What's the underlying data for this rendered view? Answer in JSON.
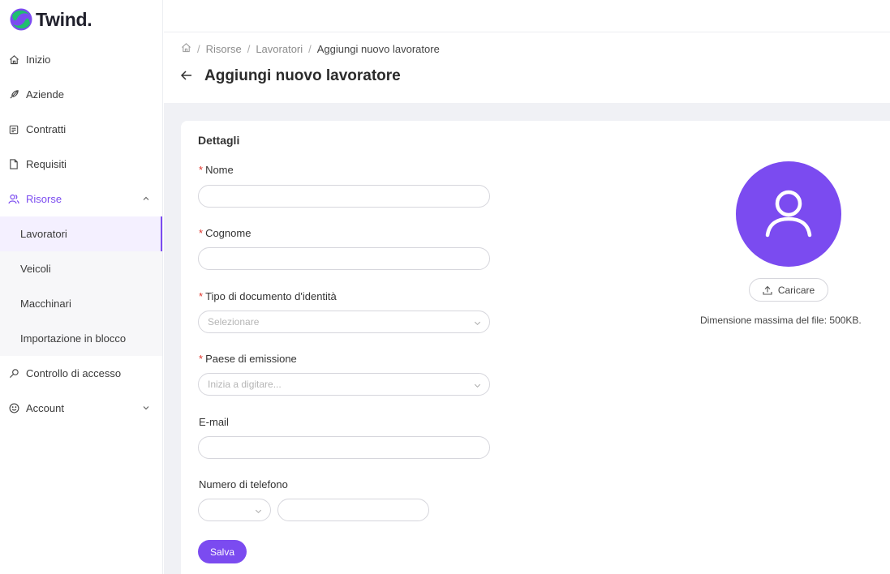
{
  "app": {
    "brand": "Twind.",
    "brand_colors": {
      "accent": "#7b4bf0",
      "green": "#1fbf6e",
      "purple": "#7b4bf0"
    }
  },
  "sidebar": {
    "items": [
      {
        "label": "Inizio",
        "icon": "home-icon"
      },
      {
        "label": "Aziende",
        "icon": "rocket-icon"
      },
      {
        "label": "Contratti",
        "icon": "contract-icon"
      },
      {
        "label": "Requisiti",
        "icon": "document-icon"
      },
      {
        "label": "Risorse",
        "icon": "people-icon",
        "expanded": true
      },
      {
        "label": "Controllo di accesso",
        "icon": "key-icon"
      },
      {
        "label": "Account",
        "icon": "smile-icon"
      }
    ],
    "sub_items": [
      {
        "label": "Lavoratori",
        "selected": true
      },
      {
        "label": "Veicoli"
      },
      {
        "label": "Macchinari"
      },
      {
        "label": "Importazione in blocco"
      }
    ]
  },
  "breadcrumb": {
    "items": [
      "Risorse",
      "Lavoratori"
    ],
    "current": "Aggiungi nuovo lavoratore",
    "separator": "/"
  },
  "page": {
    "title": "Aggiungi nuovo lavoratore"
  },
  "form": {
    "section_title": "Dettagli",
    "fields": {
      "nome": {
        "label": "Nome",
        "required": true,
        "value": ""
      },
      "cognome": {
        "label": "Cognome",
        "required": true,
        "value": ""
      },
      "tipo_documento": {
        "label": "Tipo di documento d'identità",
        "required": true,
        "placeholder": "Selezionare"
      },
      "paese": {
        "label": "Paese di emissione",
        "required": true,
        "placeholder": "Inizia a digitare..."
      },
      "email": {
        "label": "E-mail",
        "required": false,
        "value": ""
      },
      "telefono": {
        "label": "Numero di telefono",
        "required": false,
        "value": ""
      }
    },
    "save_label": "Salva",
    "required_marker": "*"
  },
  "upload": {
    "button_label": "Caricare",
    "note": "Dimensione massima del file: 500KB."
  }
}
